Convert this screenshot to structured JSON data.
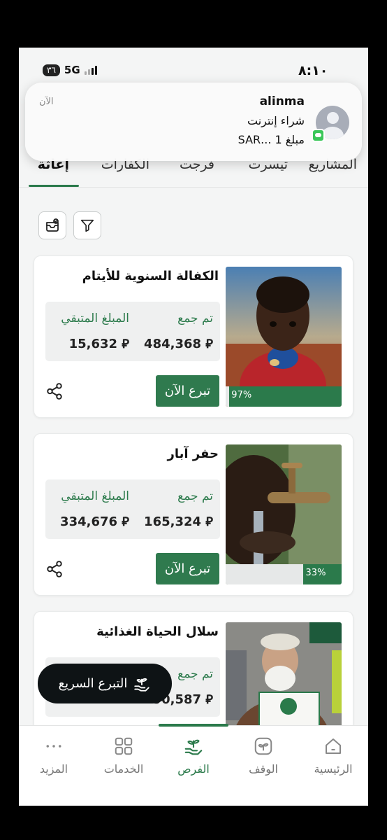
{
  "status_bar": {
    "time": "٨:١٠",
    "network": "5G",
    "battery": "٣٦"
  },
  "notification": {
    "app": "alinma",
    "time": "الآن",
    "line1": "شراء إنترنت",
    "line2": "مبلغ 1 ...SAR"
  },
  "tabs": [
    {
      "label": "المشاريع",
      "active": false
    },
    {
      "label": "تيسرت",
      "active": false
    },
    {
      "label": "فرجت",
      "active": false
    },
    {
      "label": "الكفارات",
      "active": false
    },
    {
      "label": "إعاثة",
      "active": true
    }
  ],
  "toolbar": {
    "filter_icon": "filter-icon",
    "sort_icon": "sort-icon"
  },
  "cards": [
    {
      "title": "الكفالة السنوية للأيتام",
      "collected_label": "تم جمع",
      "collected": "484,368 ⃁",
      "remaining_label": "المبلغ المتبقي",
      "remaining": "15,632 ⃁",
      "progress": 0.97,
      "progress_text": "97%",
      "donate_label": "تبرع الآن"
    },
    {
      "title": "حفر آبار",
      "collected_label": "تم جمع",
      "collected": "165,324 ⃁",
      "remaining_label": "المبلغ المتبقي",
      "remaining": "334,676 ⃁",
      "progress": 0.33,
      "progress_text": "33%",
      "donate_label": "تبرع الآن"
    },
    {
      "title": "سلال الحياة الغذائية",
      "collected_label": "تم جمع",
      "collected": "90,587 ⃁",
      "remaining_label": "",
      "remaining": ""
    }
  ],
  "quick_donate": {
    "label": "التبرع السريع"
  },
  "bottom_nav": [
    {
      "label": "الرئيسية",
      "icon": "home-icon",
      "active": false
    },
    {
      "label": "الوقف",
      "icon": "waqf-icon",
      "active": false
    },
    {
      "label": "الفرص",
      "icon": "opportunities-icon",
      "active": true
    },
    {
      "label": "الخدمات",
      "icon": "services-icon",
      "active": false
    },
    {
      "label": "المزيد",
      "icon": "more-icon",
      "active": false
    }
  ],
  "colors": {
    "brand_green": "#2b7a4b",
    "dark": "#0e1315"
  }
}
